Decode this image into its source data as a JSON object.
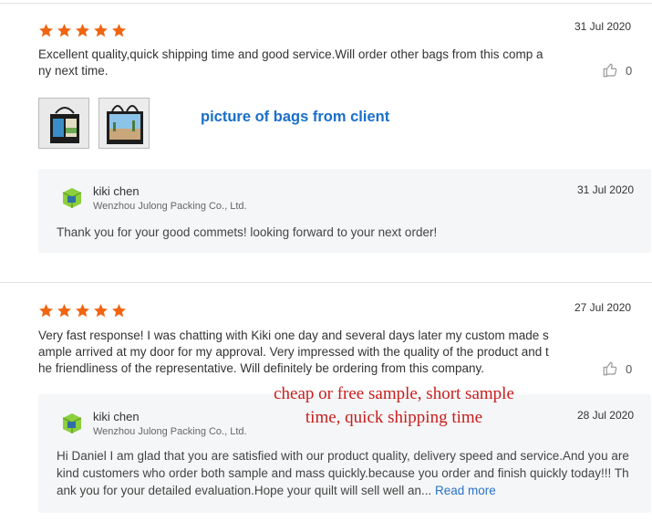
{
  "colors": {
    "star": "#f06512",
    "annotation_blue": "#1a6fc9",
    "annotation_red": "#c81d1d",
    "link": "#2a73c4"
  },
  "reviews": [
    {
      "rating": 5,
      "date": "31 Jul 2020",
      "text": "Excellent quality,quick shipping time and good service.Will order other bags from this comp any next time.",
      "likes": "0",
      "thumbnails": [
        "bag-photo-1",
        "bag-photo-2"
      ],
      "annotation": "picture of bags from client",
      "reply": {
        "name": "kiki chen",
        "company": "Wenzhou Julong Packing Co., Ltd.",
        "date": "31 Jul 2020",
        "text": "Thank you for your good commets! looking forward to your next order!"
      }
    },
    {
      "rating": 5,
      "date": "27 Jul 2020",
      "text": "Very fast response! I was chatting with Kiki one day and several days later my custom made sample arrived at my door for my approval.  Very impressed with the quality of the product and the friendliness of the representative.  Will definitely be ordering from this company.",
      "likes": "0",
      "annotation_line1": "cheap or free sample,  short  sample",
      "annotation_line2": "time,  quick shipping time",
      "reply": {
        "name": "kiki chen",
        "company": "Wenzhou Julong Packing Co., Ltd.",
        "date": "28 Jul 2020",
        "text": "Hi Daniel  I am glad that you are satisfied with our product quality, delivery speed and service.And you are kind customers who order both sample and mass quickly.because you order and finish quickly today!!! Thank you for your detailed evaluation.Hope your quilt will sell well an...",
        "more_label": "Read more"
      }
    }
  ]
}
